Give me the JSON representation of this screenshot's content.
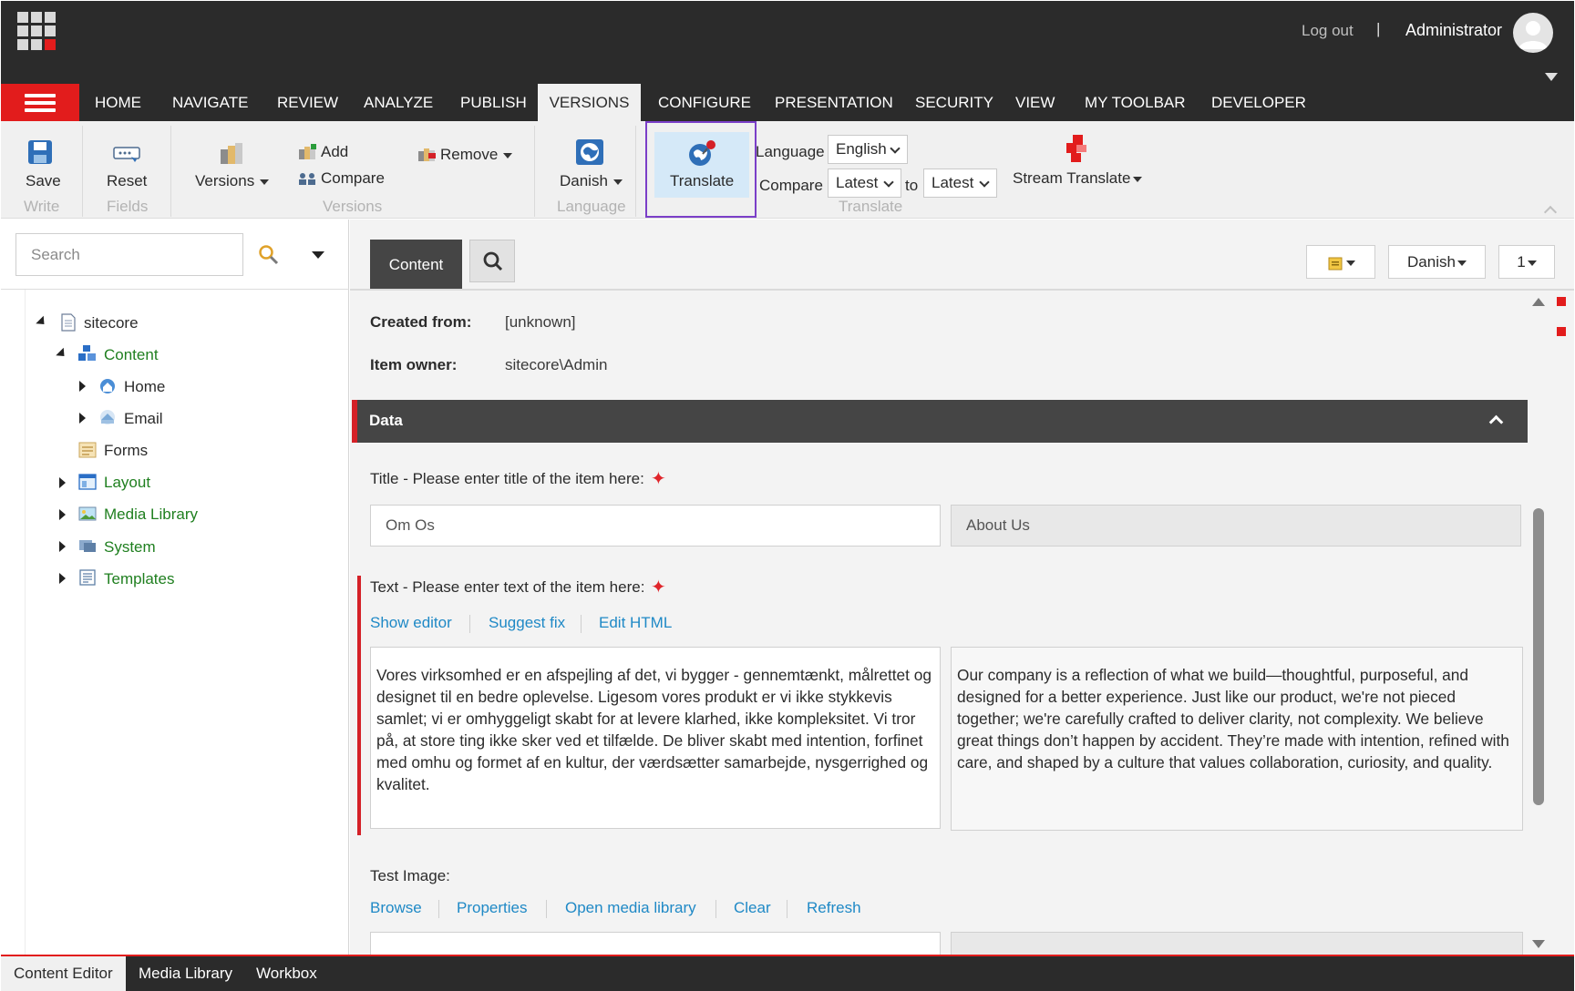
{
  "topbar": {
    "logout_label": "Log out",
    "separator": "|",
    "user_name": "Administrator"
  },
  "menu": {
    "tabs": [
      "HOME",
      "NAVIGATE",
      "REVIEW",
      "ANALYZE",
      "PUBLISH",
      "VERSIONS",
      "CONFIGURE",
      "PRESENTATION",
      "SECURITY",
      "VIEW",
      "MY TOOLBAR",
      "DEVELOPER"
    ],
    "active_tab": "VERSIONS"
  },
  "ribbon": {
    "save_label": "Save",
    "write_group": "Write",
    "reset_label": "Reset",
    "fields_group": "Fields",
    "versions_label": "Versions",
    "add_label": "Add",
    "compare_label": "Compare",
    "remove_label": "Remove",
    "versions_group": "Versions",
    "danish_label": "Danish",
    "language_group": "Language",
    "translate_label": "Translate",
    "language_label": "Language",
    "language_value": "English",
    "compare_row_label": "Compare",
    "compare_from": "Latest",
    "to_label": "to",
    "compare_to": "Latest",
    "translate_group": "Translate",
    "stream_translate_label": "Stream Translate"
  },
  "sidebar": {
    "search_placeholder": "Search",
    "tree": {
      "root": "sitecore",
      "content": "Content",
      "home": "Home",
      "email": "Email",
      "forms": "Forms",
      "layout": "Layout",
      "media_library": "Media Library",
      "system": "System",
      "templates": "Templates"
    }
  },
  "editor": {
    "content_tab": "Content",
    "language_button": "Danish",
    "version_button": "1",
    "created_from_label": "Created from:",
    "created_from_value": "[unknown]",
    "item_owner_label": "Item owner:",
    "item_owner_value": "sitecore\\Admin",
    "section_title": "Data",
    "title_field_label": "Title - Please enter title of the item here:",
    "title_value": "Om Os",
    "title_original": "About Us",
    "text_field_label": "Text - Please enter text of the item here:",
    "text_links": [
      "Show editor",
      "Suggest fix",
      "Edit HTML"
    ],
    "text_value": "Vores virksomhed er en afspejling af det, vi bygger - gennemtænkt, målrettet og designet til en bedre oplevelse. Ligesom vores produkt er vi ikke stykkevis samlet; vi er omhyggeligt skabt for at levere klarhed, ikke kompleksitet. Vi tror på, at store ting ikke sker ved et tilfælde. De bliver skabt med intention, forfinet med omhu og formet af en kultur, der værdsætter samarbejde, nysgerrighed og kvalitet.",
    "text_original": "Our company is a reflection of what we build—thoughtful, purposeful, and designed for a better experience. Just like our product, we're not pieced together; we're carefully crafted to deliver clarity, not complexity. We believe great things don’t happen by accident. They’re made with intention, refined with care, and shaped by a culture that values collaboration, curiosity, and quality.",
    "image_field_label": "Test Image:",
    "image_links": [
      "Browse",
      "Properties",
      "Open media library",
      "Clear",
      "Refresh"
    ]
  },
  "bottombar": {
    "tabs": [
      "Content Editor",
      "Media Library",
      "Workbox"
    ],
    "active_tab": "Content Editor"
  },
  "colors": {
    "accent_red": "#e21c1c",
    "dark_bar": "#2b2b2b",
    "link_blue": "#1f89c6",
    "tree_green": "#1f7f1f",
    "highlight_purple": "#7b3fc8"
  }
}
